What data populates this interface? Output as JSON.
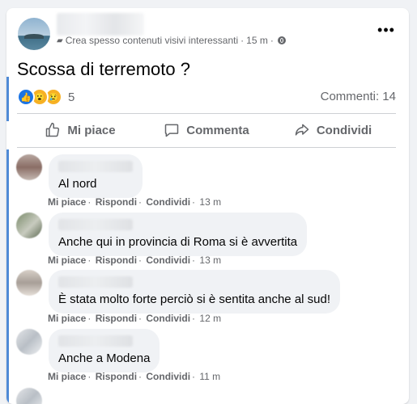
{
  "post": {
    "meta_text": "Crea spesso contenuti visivi interessanti",
    "time": "15 m",
    "dot": "·",
    "text": "Scossa di terremoto ?",
    "reaction_count": "5",
    "comments_count": "Commenti: 14",
    "icons": [
      "badge-icon",
      "globe-icon",
      "like-reaction-icon",
      "wow-reaction-icon",
      "sad-reaction-icon",
      "more-options-icon"
    ]
  },
  "actions": {
    "like": "Mi piace",
    "comment": "Commenta",
    "share": "Condividi"
  },
  "comments": [
    {
      "text": "Al nord",
      "like": "Mi piace",
      "reply": "Rispondi",
      "share": "Condividi",
      "time": "13 m"
    },
    {
      "text": "Anche qui in provincia di Roma si è avvertita",
      "like": "Mi piace",
      "reply": "Rispondi",
      "share": "Condividi",
      "time": "13 m"
    },
    {
      "text": "È stata molto forte perciò si è sentita anche al sud!",
      "like": "Mi piace",
      "reply": "Rispondi",
      "share": "Condividi",
      "time": "12 m"
    },
    {
      "text": "Anche a Modena",
      "like": "Mi piace",
      "reply": "Rispondi",
      "share": "Condividi",
      "time": "11 m"
    }
  ],
  "colors": {
    "accent": "#1b74e4",
    "secondary_text": "#65676b",
    "bubble": "#f0f2f5",
    "focus_bar": "#4f8ad6"
  }
}
